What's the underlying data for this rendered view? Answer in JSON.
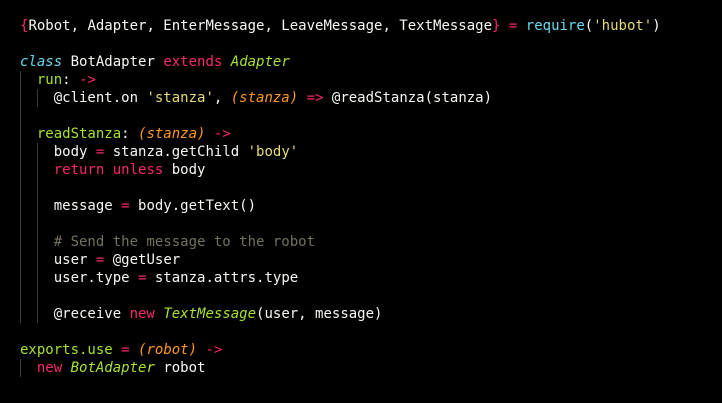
{
  "colors": {
    "background": "#000000",
    "default": "#f8f8f2",
    "keyword": "#f92672",
    "class_keyword": "#66d9ef",
    "type": "#a6e22e",
    "string": "#e6db74",
    "param": "#fd971f",
    "function_call": "#66d9ef",
    "comment": "#75715e",
    "indent_guide": "#3a3a3a"
  },
  "lines": [
    {
      "indent": 0,
      "tokens": [
        {
          "t": "{",
          "c": "keyword"
        },
        {
          "t": "Robot, Adapter, EnterMessage, LeaveMessage, TextMessage",
          "c": "default"
        },
        {
          "t": "}",
          "c": "keyword"
        },
        {
          "t": " ",
          "c": "default"
        },
        {
          "t": "=",
          "c": "keyword"
        },
        {
          "t": " ",
          "c": "default"
        },
        {
          "t": "require",
          "c": "function_call"
        },
        {
          "t": "(",
          "c": "default"
        },
        {
          "t": "'hubot'",
          "c": "string"
        },
        {
          "t": ")",
          "c": "default"
        }
      ]
    },
    {
      "indent": 0,
      "tokens": []
    },
    {
      "indent": 0,
      "tokens": [
        {
          "t": "class",
          "c": "class_keyword",
          "i": true
        },
        {
          "t": " BotAdapter ",
          "c": "default"
        },
        {
          "t": "extends",
          "c": "keyword"
        },
        {
          "t": " ",
          "c": "default"
        },
        {
          "t": "Adapter",
          "c": "type",
          "i": true
        }
      ]
    },
    {
      "indent": 1,
      "tokens": [
        {
          "t": "run",
          "c": "type"
        },
        {
          "t": ": ",
          "c": "default"
        },
        {
          "t": "->",
          "c": "keyword"
        }
      ]
    },
    {
      "indent": 2,
      "tokens": [
        {
          "t": "@client.on ",
          "c": "default"
        },
        {
          "t": "'stanza'",
          "c": "string"
        },
        {
          "t": ", ",
          "c": "default"
        },
        {
          "t": "(stanza)",
          "c": "param",
          "i": true
        },
        {
          "t": " ",
          "c": "default"
        },
        {
          "t": "=>",
          "c": "keyword"
        },
        {
          "t": " @readStanza(stanza)",
          "c": "default"
        }
      ]
    },
    {
      "indent": 1,
      "tokens": []
    },
    {
      "indent": 1,
      "tokens": [
        {
          "t": "readStanza",
          "c": "type"
        },
        {
          "t": ": ",
          "c": "default"
        },
        {
          "t": "(stanza)",
          "c": "param",
          "i": true
        },
        {
          "t": " ",
          "c": "default"
        },
        {
          "t": "->",
          "c": "keyword"
        }
      ]
    },
    {
      "indent": 2,
      "tokens": [
        {
          "t": "body ",
          "c": "default"
        },
        {
          "t": "=",
          "c": "keyword"
        },
        {
          "t": " stanza.getChild ",
          "c": "default"
        },
        {
          "t": "'body'",
          "c": "string"
        }
      ]
    },
    {
      "indent": 2,
      "tokens": [
        {
          "t": "return",
          "c": "keyword"
        },
        {
          "t": " ",
          "c": "default"
        },
        {
          "t": "unless",
          "c": "keyword"
        },
        {
          "t": " body",
          "c": "default"
        }
      ]
    },
    {
      "indent": 2,
      "tokens": []
    },
    {
      "indent": 2,
      "tokens": [
        {
          "t": "message ",
          "c": "default"
        },
        {
          "t": "=",
          "c": "keyword"
        },
        {
          "t": " body.getText()",
          "c": "default"
        }
      ]
    },
    {
      "indent": 2,
      "tokens": []
    },
    {
      "indent": 2,
      "tokens": [
        {
          "t": "# Send the message to the robot",
          "c": "comment"
        }
      ]
    },
    {
      "indent": 2,
      "tokens": [
        {
          "t": "user ",
          "c": "default"
        },
        {
          "t": "=",
          "c": "keyword"
        },
        {
          "t": " @getUser",
          "c": "default"
        }
      ]
    },
    {
      "indent": 2,
      "tokens": [
        {
          "t": "user.type ",
          "c": "default"
        },
        {
          "t": "=",
          "c": "keyword"
        },
        {
          "t": " stanza.attrs.type",
          "c": "default"
        }
      ]
    },
    {
      "indent": 2,
      "tokens": []
    },
    {
      "indent": 2,
      "tokens": [
        {
          "t": "@receive ",
          "c": "default"
        },
        {
          "t": "new",
          "c": "keyword"
        },
        {
          "t": " ",
          "c": "default"
        },
        {
          "t": "TextMessage",
          "c": "type",
          "i": true
        },
        {
          "t": "(user, message)",
          "c": "default"
        }
      ]
    },
    {
      "indent": 0,
      "tokens": []
    },
    {
      "indent": 0,
      "tokens": [
        {
          "t": "exports.use ",
          "c": "type"
        },
        {
          "t": "=",
          "c": "keyword"
        },
        {
          "t": " ",
          "c": "default"
        },
        {
          "t": "(robot)",
          "c": "param",
          "i": true
        },
        {
          "t": " ",
          "c": "default"
        },
        {
          "t": "->",
          "c": "keyword"
        }
      ]
    },
    {
      "indent": 1,
      "tokens": [
        {
          "t": "new",
          "c": "keyword"
        },
        {
          "t": " ",
          "c": "default"
        },
        {
          "t": "BotAdapter",
          "c": "type",
          "i": true
        },
        {
          "t": " robot",
          "c": "default"
        }
      ]
    }
  ]
}
